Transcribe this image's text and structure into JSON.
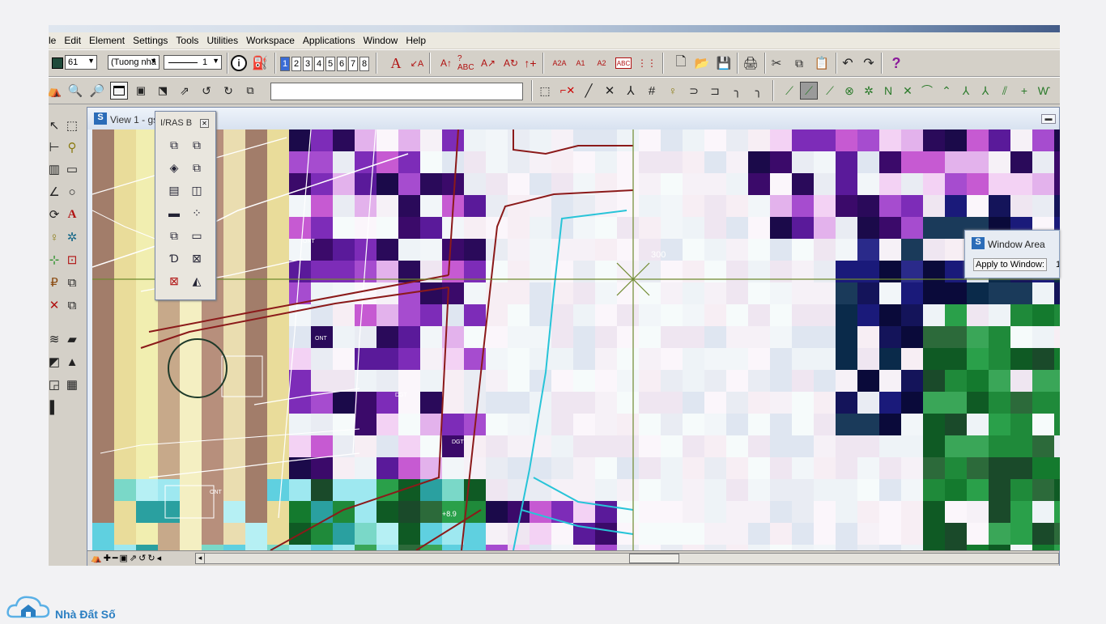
{
  "menu": {
    "items": [
      "le",
      "Edit",
      "Element",
      "Settings",
      "Tools",
      "Utilities",
      "Workspace",
      "Applications",
      "Window",
      "Help"
    ]
  },
  "attributes": {
    "color_value": "61",
    "style_value": "(Tuong nhá",
    "weight_value": "1"
  },
  "view_numbers": [
    "1",
    "2",
    "3",
    "4",
    "5",
    "6",
    "7",
    "8"
  ],
  "view_window": {
    "title": "View 1 - gs",
    "coordinate_label": "300"
  },
  "iras_palette": {
    "title": "I/RAS B"
  },
  "window_area": {
    "title": "Window Area",
    "apply_label": "Apply to Window:",
    "apply_value": "1"
  },
  "map_labels": {
    "ont_1": "ONT",
    "ont_2": "ONT",
    "ont_3": "ONT",
    "dgt_1": "DGT",
    "dgt_2": "DGT",
    "value_1": "+8.9"
  },
  "brand": {
    "text": "Nhà Đất Số"
  },
  "colors": {
    "accent": "#3a6cd6",
    "parcel_line": "#8b1a1a",
    "channel_line": "#27c4d8",
    "crosshair": "#6f8a2f"
  }
}
